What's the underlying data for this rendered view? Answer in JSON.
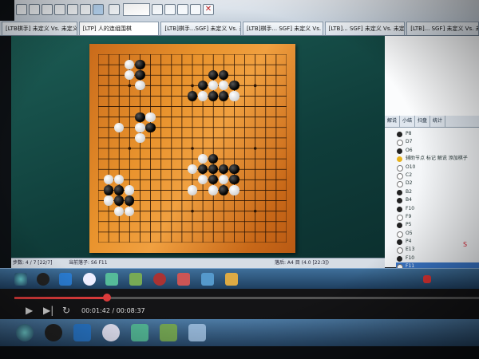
{
  "toolbar": {
    "dropdown_label": "",
    "icons": [
      "new-file-icon",
      "open-icon",
      "save-icon",
      "print-icon",
      "undo-icon",
      "redo-icon",
      "first-move-icon",
      "prev-move-icon",
      "next-move-icon",
      "last-move-icon",
      "close-red-icon"
    ]
  },
  "tabs": [
    {
      "label": "[LTB棋手] 未定义 Vs. 未定义"
    },
    {
      "label": "[LTP] 人的连组围棋",
      "active": true
    },
    {
      "label": "[LTB]棋手...SGF] 未定义 Vs. 未定义"
    },
    {
      "label": "[LTB]棋手... SGF] 未定义 Vs. 未定义"
    },
    {
      "label": "[LTB]... SGF] 未定义 Vs. 未定义"
    },
    {
      "label": "[LTB]... SGF] 未定义 Vs. 未定义"
    }
  ],
  "board": {
    "size": 19,
    "black": [
      [
        4,
        1
      ],
      [
        4,
        2
      ],
      [
        4,
        3
      ],
      [
        10,
        3
      ],
      [
        11,
        2
      ],
      [
        12,
        2
      ],
      [
        13,
        3
      ],
      [
        9,
        4
      ],
      [
        11,
        4
      ],
      [
        12,
        4
      ],
      [
        4,
        6
      ],
      [
        5,
        7
      ],
      [
        11,
        10
      ],
      [
        10,
        11
      ],
      [
        11,
        11
      ],
      [
        12,
        11
      ],
      [
        13,
        11
      ],
      [
        11,
        12
      ],
      [
        13,
        12
      ],
      [
        12,
        13
      ],
      [
        1,
        13
      ],
      [
        2,
        13
      ],
      [
        2,
        14
      ],
      [
        3,
        14
      ]
    ],
    "white": [
      [
        3,
        1
      ],
      [
        3,
        2
      ],
      [
        4,
        3
      ],
      [
        10,
        4
      ],
      [
        12,
        3
      ],
      [
        13,
        4
      ],
      [
        11,
        3
      ],
      [
        5,
        6
      ],
      [
        4,
        7
      ],
      [
        2,
        7
      ],
      [
        4,
        8
      ],
      [
        10,
        10
      ],
      [
        9,
        11
      ],
      [
        11,
        13
      ],
      [
        10,
        12
      ],
      [
        12,
        12
      ],
      [
        13,
        13
      ],
      [
        9,
        13
      ],
      [
        1,
        12
      ],
      [
        2,
        12
      ],
      [
        3,
        13
      ],
      [
        1,
        14
      ],
      [
        3,
        15
      ],
      [
        2,
        15
      ]
    ]
  },
  "panel": {
    "tabs": [
      "解说",
      "小结",
      "扫盘",
      "统计"
    ],
    "moves": [
      {
        "label": "P8",
        "color": "b"
      },
      {
        "label": "D7",
        "color": "w"
      },
      {
        "label": "O6",
        "color": "b"
      },
      {
        "label": "辅助节点 标记 解说 添加棋子",
        "color": "y"
      },
      {
        "label": "O10",
        "color": "w"
      },
      {
        "label": "C2",
        "color": "w"
      },
      {
        "label": "D2",
        "color": "w"
      },
      {
        "label": "B2",
        "color": "b"
      },
      {
        "label": "B4",
        "color": "b"
      },
      {
        "label": "F10",
        "color": "b"
      },
      {
        "label": "F9",
        "color": "w"
      },
      {
        "label": "P5",
        "color": "b"
      },
      {
        "label": "O5",
        "color": "w"
      },
      {
        "label": "P4",
        "color": "b"
      },
      {
        "label": "E13",
        "color": "w"
      },
      {
        "label": "F10",
        "color": "b"
      },
      {
        "label": "F11",
        "color": "w",
        "selected": true
      }
    ],
    "side_text": "S"
  },
  "status": {
    "left": "步数: 4 / 7 [22/7]",
    "middle": "当前落子: S6 F11",
    "right": "落后: A4 目 (4.0 [22:3])"
  },
  "player": {
    "time": "00:01:42 / 00:08:37",
    "progress": 0.2
  }
}
